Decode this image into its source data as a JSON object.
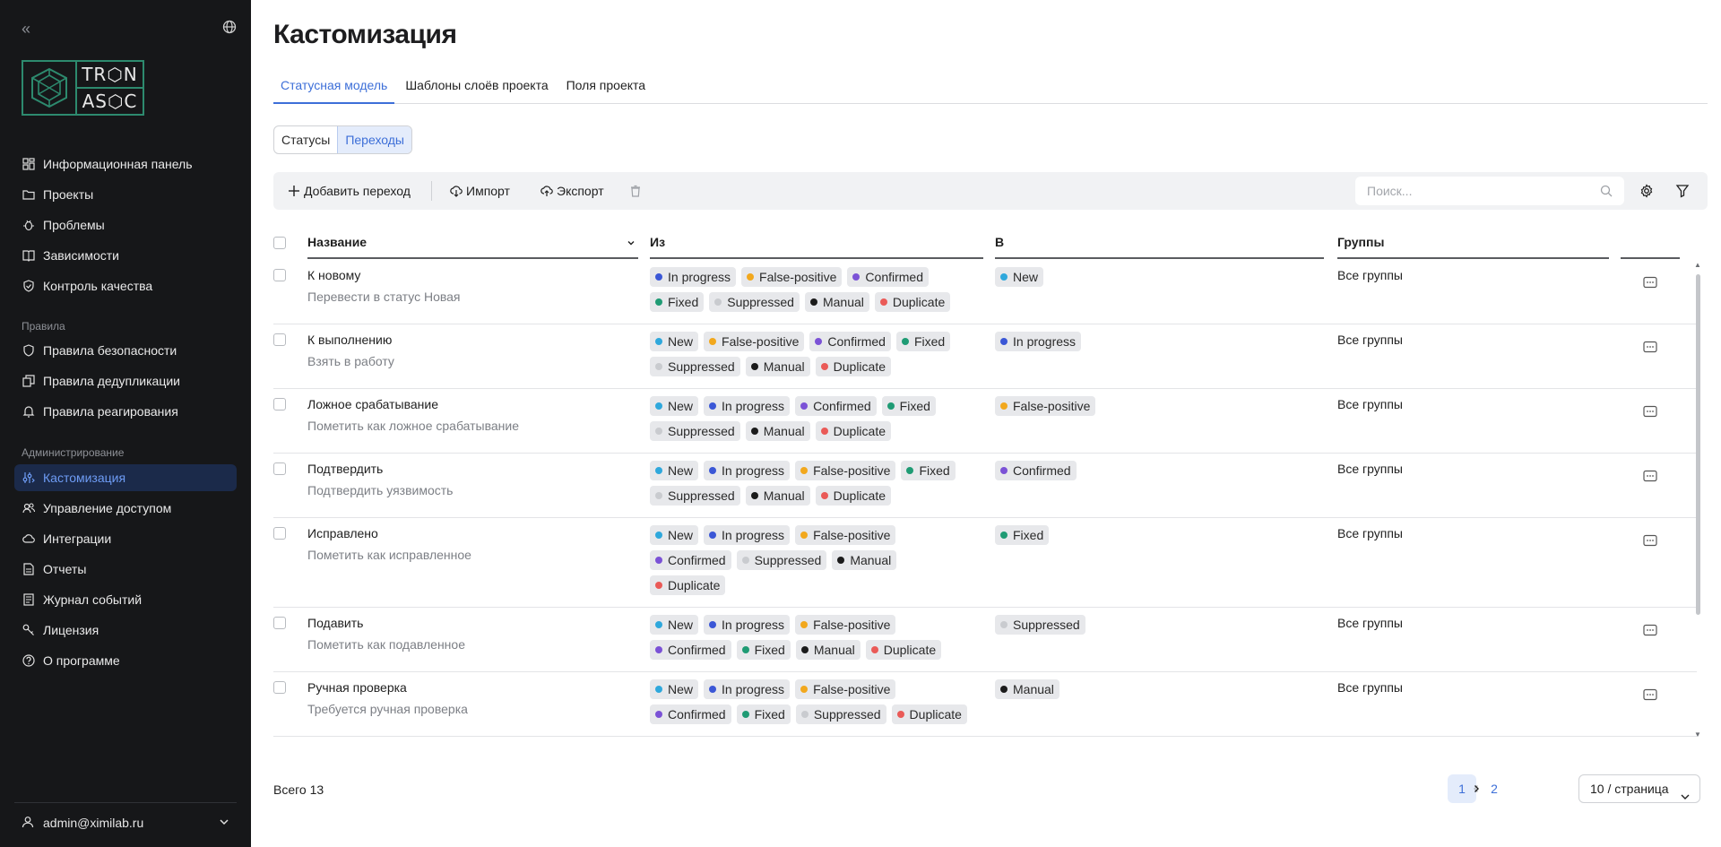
{
  "sidebar": {
    "logo": {
      "line1": "TR⬡N",
      "line2": "AS⬡C"
    },
    "nav_main": [
      {
        "label": "Информационная панель",
        "icon": "dashboard-icon"
      },
      {
        "label": "Проекты",
        "icon": "folder-icon"
      },
      {
        "label": "Проблемы",
        "icon": "bug-icon"
      },
      {
        "label": "Зависимости",
        "icon": "book-icon"
      },
      {
        "label": "Контроль качества",
        "icon": "shield-check-icon"
      }
    ],
    "section_rules": "Правила",
    "nav_rules": [
      {
        "label": "Правила безопасности",
        "icon": "shield-icon"
      },
      {
        "label": "Правила дедупликации",
        "icon": "copy-icon"
      },
      {
        "label": "Правила реагирования",
        "icon": "bell-icon"
      }
    ],
    "section_admin": "Администрирование",
    "nav_admin": [
      {
        "label": "Кастомизация",
        "icon": "sliders-icon",
        "active": true
      },
      {
        "label": "Управление доступом",
        "icon": "users-icon"
      },
      {
        "label": "Интеграции",
        "icon": "cloud-icon"
      },
      {
        "label": "Отчеты",
        "icon": "file-icon"
      },
      {
        "label": "Журнал событий",
        "icon": "journal-icon"
      },
      {
        "label": "Лицензия",
        "icon": "key-icon"
      },
      {
        "label": "О программе",
        "icon": "help-icon"
      }
    ],
    "user": "admin@ximilab.ru"
  },
  "page": {
    "title": "Кастомизация",
    "tabs": [
      "Статусная модель",
      "Шаблоны слоёв проекта",
      "Поля проекта"
    ],
    "segments": [
      "Статусы",
      "Переходы"
    ]
  },
  "toolbar": {
    "add_label": "Добавить переход",
    "import_label": "Импорт",
    "export_label": "Экспорт",
    "search_placeholder": "Поиск..."
  },
  "statuses": {
    "New": "#2fa8dc",
    "In progress": "#3b57d6",
    "False-positive": "#f2a81d",
    "Confirmed": "#7b52d6",
    "Fixed": "#1f9b74",
    "Suppressed": "#c9cbcf",
    "Manual": "#1b1b1b",
    "Duplicate": "#ea5a57"
  },
  "table": {
    "columns": {
      "name": "Название",
      "from": "Из",
      "to": "В",
      "groups": "Группы"
    },
    "rows": [
      {
        "title": "К новому",
        "desc": "Перевести в статус Новая",
        "from": [
          "In progress",
          "False-positive",
          "Confirmed",
          "Fixed",
          "Suppressed",
          "Manual",
          "Duplicate"
        ],
        "to": [
          "New"
        ],
        "groups": "Все группы"
      },
      {
        "title": "К выполнению",
        "desc": "Взять в работу",
        "from": [
          "New",
          "False-positive",
          "Confirmed",
          "Fixed",
          "Suppressed",
          "Manual",
          "Duplicate"
        ],
        "to": [
          "In progress"
        ],
        "groups": "Все группы"
      },
      {
        "title": "Ложное срабатывание",
        "desc": "Пометить как ложное срабатывание",
        "from": [
          "New",
          "In progress",
          "Confirmed",
          "Fixed",
          "Suppressed",
          "Manual",
          "Duplicate"
        ],
        "to": [
          "False-positive"
        ],
        "groups": "Все группы"
      },
      {
        "title": "Подтвердить",
        "desc": "Подтвердить уязвимость",
        "from": [
          "New",
          "In progress",
          "False-positive",
          "Fixed",
          "Suppressed",
          "Manual",
          "Duplicate"
        ],
        "to": [
          "Confirmed"
        ],
        "groups": "Все группы"
      },
      {
        "title": "Исправлено",
        "desc": "Пометить как исправленное",
        "from": [
          "New",
          "In progress",
          "False-positive",
          "Confirmed",
          "Suppressed",
          "Manual",
          "Duplicate"
        ],
        "to": [
          "Fixed"
        ],
        "groups": "Все группы"
      },
      {
        "title": "Подавить",
        "desc": "Пометить как подавленное",
        "from": [
          "New",
          "In progress",
          "False-positive",
          "Confirmed",
          "Fixed",
          "Manual",
          "Duplicate"
        ],
        "to": [
          "Suppressed"
        ],
        "groups": "Все группы"
      },
      {
        "title": "Ручная проверка",
        "desc": "Требуется ручная проверка",
        "from": [
          "New",
          "In progress",
          "False-positive",
          "Confirmed",
          "Fixed",
          "Suppressed",
          "Duplicate"
        ],
        "to": [
          "Manual"
        ],
        "groups": "Все группы"
      }
    ]
  },
  "footer": {
    "total": "Всего 13",
    "pages": [
      "1",
      "2"
    ],
    "current_page": "1",
    "page_size": "10 / страница"
  }
}
